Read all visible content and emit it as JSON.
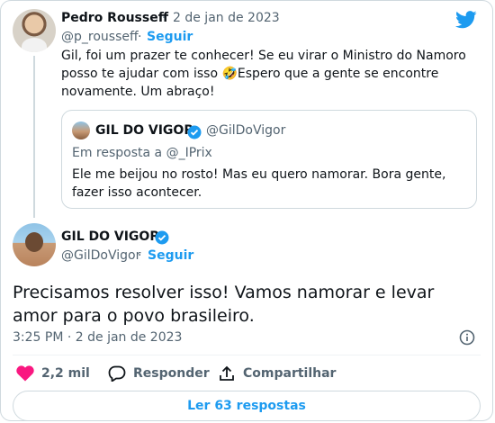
{
  "original_tweet": {
    "author_name": "Pedro Rousseff",
    "separator": "·",
    "date": "2 de jan de 2023",
    "handle": "@p_rousseff",
    "dot": "·",
    "follow_label": "Seguir",
    "text": "Gil, foi um prazer te conhecer! Se eu virar o Ministro do Namoro posso te ajudar com isso 🤣Espero que a gente se encontre novamente. Um abraço!"
  },
  "quoted_tweet": {
    "author_name": "GIL DO VIGOR",
    "handle": "@GilDoVigor",
    "reply_context": "Em resposta a @_IPrix",
    "text": "Ele me beijou no rosto! Mas eu quero namorar. Bora gente, fazer isso acontecer."
  },
  "main_tweet": {
    "author_name": "GIL DO VIGOR",
    "handle": "@GilDoVigor",
    "dot": "·",
    "follow_label": "Seguir",
    "text": "Precisamos resolver isso! Vamos namorar e levar amor para o povo brasileiro.",
    "timestamp": "3:25 PM · 2 de jan de 2023"
  },
  "actions": {
    "likes": "2,2 mil",
    "reply_label": "Responder",
    "share_label": "Compartilhar"
  },
  "read_replies_label": "Ler 63 respostas",
  "colors": {
    "brand_blue": "#1d9bf0",
    "like_pink": "#f91880",
    "muted_text": "#536471",
    "border": "#cfd9de"
  },
  "icons": [
    "twitter-bird-icon",
    "verified-badge-icon",
    "info-icon",
    "heart-icon",
    "reply-bubble-icon",
    "share-icon"
  ]
}
